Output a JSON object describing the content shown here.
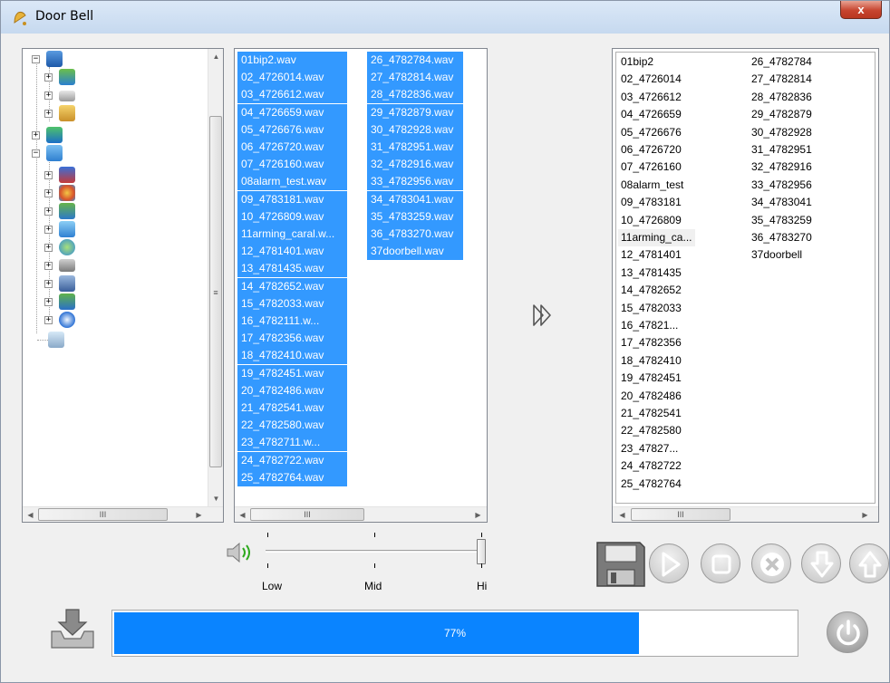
{
  "window": {
    "title": "Door Bell",
    "close_label": "x"
  },
  "file_list": [
    "01bip2.wav",
    "02_4726014.wav",
    "03_4726612.wav",
    "04_4726659.wav",
    "05_4726676.wav",
    "06_4726720.wav",
    "07_4726160.wav",
    "08alarm_test.wav",
    "09_4783181.wav",
    "10_4726809.wav",
    "11arming_caral.w...",
    "12_4781401.wav",
    "13_4781435.wav",
    "14_4782652.wav",
    "15_4782033.wav",
    "16_4782111.w...",
    "17_4782356.wav",
    "18_4782410.wav",
    "19_4782451.wav",
    "20_4782486.wav",
    "21_4782541.wav",
    "22_4782580.wav",
    "23_4782711.w...",
    "24_4782722.wav",
    "25_4782764.wav",
    "26_4782784.wav",
    "27_4782814.wav",
    "28_4782836.wav",
    "29_4782879.wav",
    "30_4782928.wav",
    "31_4782951.wav",
    "32_4782916.wav",
    "33_4782956.wav",
    "34_4783041.wav",
    "35_4783259.wav",
    "36_4783270.wav",
    "37doorbell.wav"
  ],
  "playlist": [
    "01bip2",
    "02_4726014",
    "03_4726612",
    "04_4726659",
    "05_4726676",
    "06_4726720",
    "07_4726160",
    "08alarm_test",
    "09_4783181",
    "10_4726809",
    "11arming_ca...",
    "12_4781401",
    "13_4781435",
    "14_4782652",
    "15_4782033",
    "16_47821...",
    "17_4782356",
    "18_4782410",
    "19_4782451",
    "20_4782486",
    "21_4782541",
    "22_4782580",
    "23_47827...",
    "24_4782722",
    "25_4782764",
    "26_4782784",
    "27_4782814",
    "28_4782836",
    "29_4782879",
    "30_4782928",
    "31_4782951",
    "32_4782916",
    "33_4782956",
    "34_4783041",
    "35_4783259",
    "36_4783270",
    "37doorbell"
  ],
  "scroll_glyph": "III",
  "volume": {
    "labels": {
      "low": "Low",
      "mid": "Mid",
      "hi": "Hi"
    },
    "level": 1.0
  },
  "progress": {
    "value": 0.77,
    "label": "77%"
  },
  "colors": {
    "selection": "#3399ff",
    "progress": "#0a84ff",
    "accent_green": "#2eaa1e"
  }
}
